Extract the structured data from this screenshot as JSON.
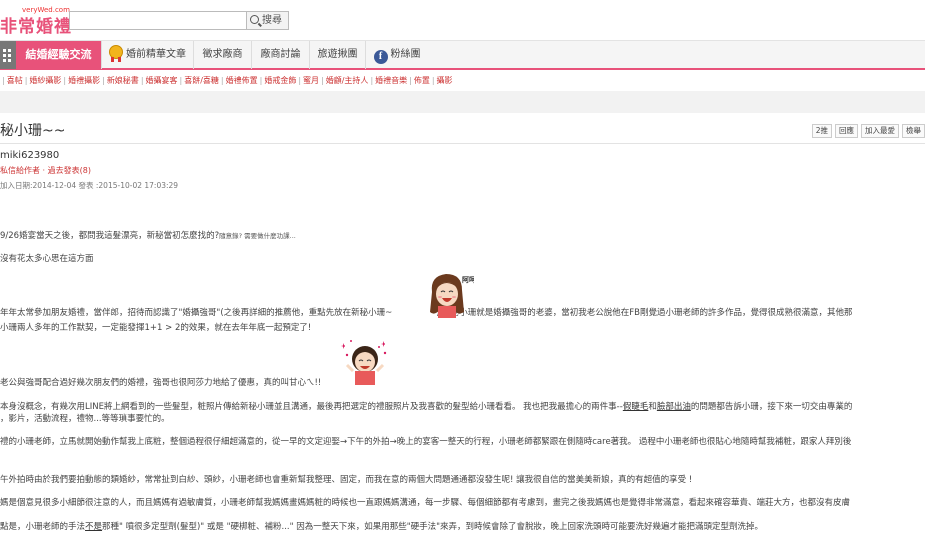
{
  "header": {
    "logo_small": "veryWed.com",
    "logo_main": "非常婚禮",
    "search_placeholder": "",
    "search_button": "搜尋"
  },
  "nav": {
    "active": "結婚經驗交流",
    "items": [
      "婚前精華文章",
      "徵求廠商",
      "廠商討論",
      "旅遊揪團",
      "粉絲團"
    ]
  },
  "subnav": [
    "喜帖",
    "婚紗攝影",
    "婚禮攝影",
    "新娘秘書",
    "婚攝宴客",
    "喜餅/喜糖",
    "婚禮佈置",
    "婚戒金飾",
    "蜜月",
    "婚顧/主持人",
    "婚禮音樂",
    "佈置",
    "攝影"
  ],
  "post": {
    "title": "秘小珊~~",
    "actions": [
      "2推",
      "回應",
      "加入最愛",
      "檢舉"
    ],
    "author": "miki623980",
    "author_links": "私信給作者 · 過去發表(8)",
    "dates": "加入日期:2014-12-04 發表 :2015-10-02 17:03:29",
    "p1_main": "9/26婚宴當天之後，都問我這髮漂亮，新秘當初怎麼找的?",
    "p1_small": "隨意錄? 需要做什麼功課...",
    "p2": "沒有花太多心思在這方面",
    "p3a_pre": "年年太常參加朋友婚禮，當伴郎，招待而認識了\"婚攝強哥\"(之後再詳細的推薦他，重點先放在新秘小珊~",
    "p3a_post": ") 新秘小珊就是婚攝強哥的老婆，當初我老公說他在FB剛覺過小珊老師的許多作品，覺得很成熟很滿意，其他那",
    "p3b": "小珊兩人多年的工作默契，一定能發揮1+1 > 2的效果，就在去年年底一起預定了!",
    "p4": "老公與強哥配合過好幾次朋友們的婚禮，強哥也很阿莎力地給了優惠，真的叫甘心ㄟ!!",
    "p5a_pre": "本身沒概念，有幾次用LINE將上網看到的一些髮型，粧照片傳給新秘小珊並且溝通，最後再把選定的禮服照片及我喜歡的髮型給小珊看看。 我也把我最擔心的兩件事--",
    "p5a_u1": "假睫毛",
    "p5a_mid": "和",
    "p5a_u2": "臉部出油",
    "p5a_post": "的問題都告訴小珊，接下來一切交由專業的",
    "p5b": "，影片，活動流程，禮物...等等瑣事要忙的。",
    "p6": "禮的小珊老師，立馬就開始動作幫我上底粧，整個過程很仔細超滿意的，從一早的文定迎娶→下午的外拍→晚上的宴客一整天的行程，小珊老師都緊跟在側隨時care著我。 過程中小珊老師也很貼心地隨時幫我補粧，跟家人拜別後",
    "p7": "午外拍時由於我們要拍動態的類婚紗，常常扯到白紗、頭紗，小珊老師也會重新幫我整理、固定，而我在意的兩個大問題通通都沒發生呢! 讓我很自信的當美美新娘，真的有超值的享受 !",
    "p8": "媽是個意見很多小細節很注意的人，而且媽媽有過敏膚質，小珊老師幫我媽媽畫媽媽粧的時候也一直跟媽媽溝通，每一步驟、每個細節都有考慮到，畫完之後我媽媽也是覺得非常滿意，看起來確容華貴、端莊大方，也都沒有皮膚",
    "p9_pre": "點是，小珊老師的手法",
    "p9_u": "不是",
    "p9_post": "那種\" 噴很多定型劑(髮型)\" 或是 \"硬梆粧、補粉...\" 因為一整天下來，如果用那些\"硬手法\"來弄，到時候會除了會脫妝，晚上回家洗頭時可能要洗好幾遍才能把滿頭定型劑洗掉。",
    "sticker1_text": "阿呵"
  },
  "colors": {
    "brand": "#e8527a",
    "link": "#cc3333"
  }
}
